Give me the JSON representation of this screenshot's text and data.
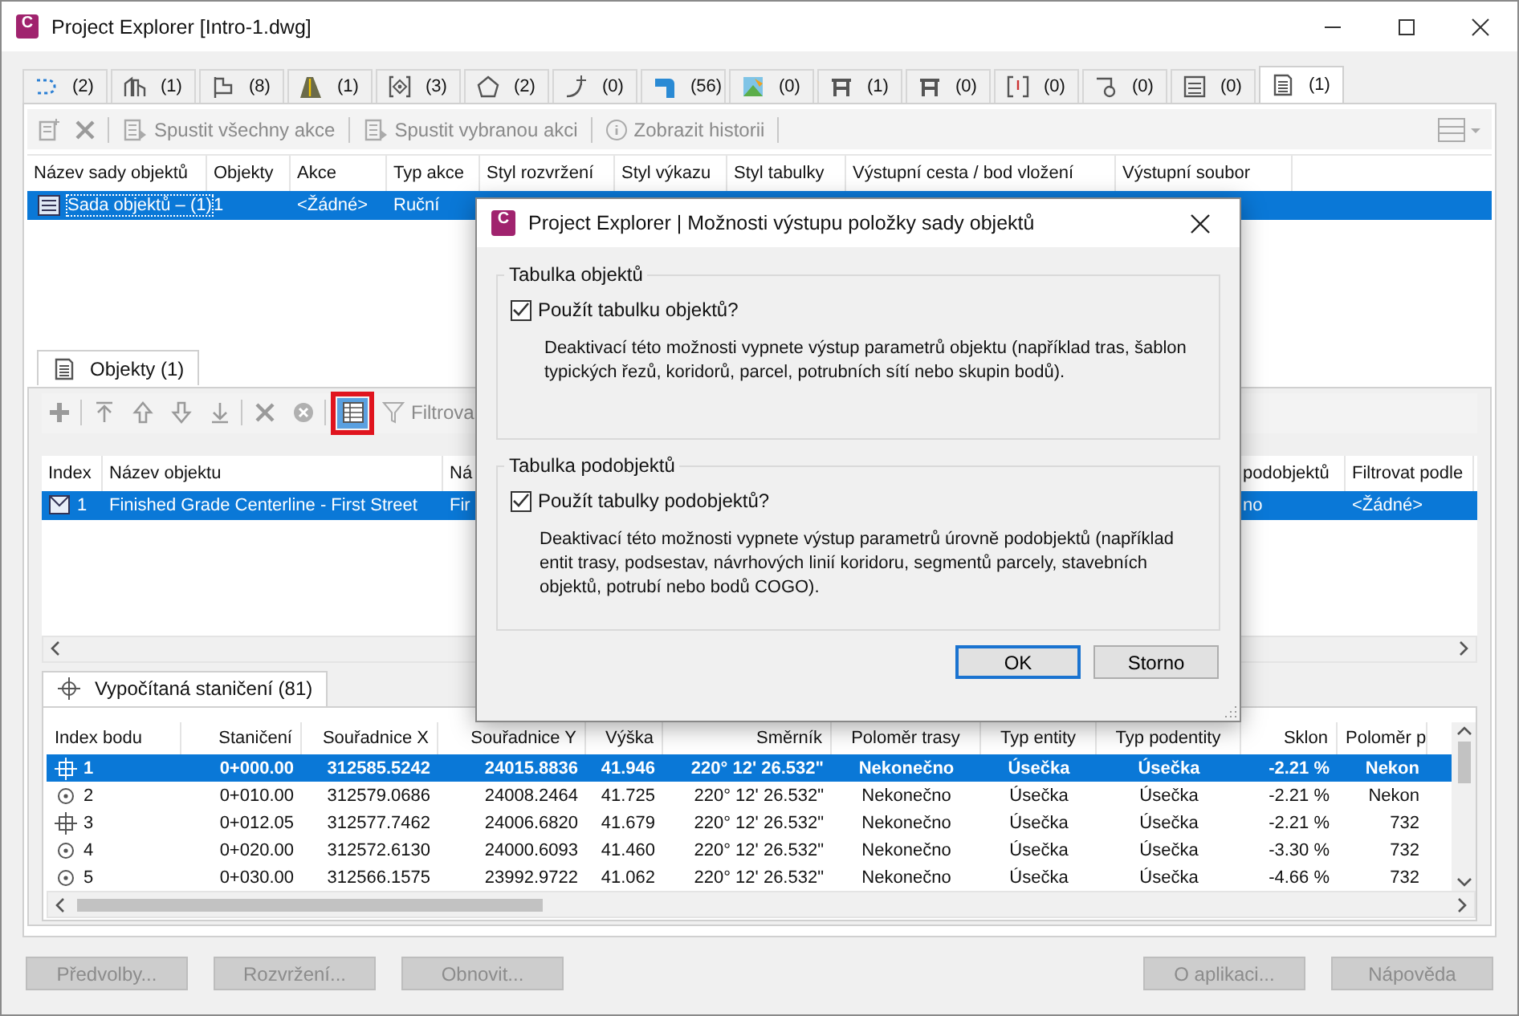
{
  "window": {
    "icon_letter": "C",
    "title": "Project Explorer [Intro-1.dwg]"
  },
  "object_type_tabs": [
    {
      "count": "(2)",
      "selected": false
    },
    {
      "count": "(1)",
      "selected": false
    },
    {
      "count": "(8)",
      "selected": false
    },
    {
      "count": "(1)",
      "selected": false
    },
    {
      "count": "(3)",
      "selected": false
    },
    {
      "count": "(2)",
      "selected": false
    },
    {
      "count": "(0)",
      "selected": false
    },
    {
      "count": "(56)",
      "selected": false
    },
    {
      "count": "(0)",
      "selected": false
    },
    {
      "count": "(1)",
      "selected": false
    },
    {
      "count": "(0)",
      "selected": false
    },
    {
      "count": "(0)",
      "selected": false
    },
    {
      "count": "(0)",
      "selected": false
    },
    {
      "count": "(0)",
      "selected": false
    },
    {
      "count": "(1)",
      "selected": true
    }
  ],
  "toolbar": {
    "buttons": [
      {
        "label": "Spustit všechny akce",
        "disabled": true
      },
      {
        "label": "Spustit vybranou akci",
        "disabled": true
      },
      {
        "label": "Zobrazit historii",
        "disabled": true
      }
    ]
  },
  "object_sets": {
    "columns": [
      "Název sady objektů",
      "Objekty",
      "Akce",
      "Typ akce",
      "Styl rozvržení",
      "Styl výkazu",
      "Styl tabulky",
      "Výstupní cesta / bod vložení",
      "Výstupní soubor"
    ],
    "rows": [
      {
        "selected": true,
        "cells": [
          "Sada objektů – (1)",
          "1",
          "<Žádné>",
          "Ruční"
        ]
      }
    ]
  },
  "objects_tab": {
    "label": "Objekty (1)"
  },
  "objects_toolbar": {
    "tools": [
      {
        "disabled": true,
        "highlighted": false
      },
      {
        "disabled": true,
        "highlighted": false
      },
      {
        "disabled": true,
        "highlighted": false
      },
      {
        "disabled": true,
        "highlighted": false
      },
      {
        "disabled": true,
        "highlighted": false
      },
      {
        "disabled": true,
        "highlighted": false
      },
      {
        "disabled": true,
        "highlighted": false
      },
      {
        "disabled": false,
        "highlighted": true
      }
    ],
    "filter_label": "Filtrova"
  },
  "objects": {
    "columns": [
      "Index",
      "Název objektu",
      "Ná",
      "podobjektů",
      "Filtrovat podle"
    ],
    "rows": [
      {
        "selected": true,
        "cells": [
          "1",
          "Finished Grade Centerline - First Street",
          "Fir",
          "no",
          "<Žádné>"
        ]
      }
    ]
  },
  "stations": {
    "tab": "Vypočítaná staničení (81)",
    "columns": [
      "Index bodu",
      "Staničení",
      "Souřadnice X",
      "Souřadnice Y",
      "Výška",
      "Směrník",
      "Poloměr trasy",
      "Typ entity",
      "Typ podentity",
      "Sklon",
      "Poloměr p"
    ],
    "rows": [
      {
        "kind": "crosshair",
        "selected": true,
        "cells": [
          "1",
          "0+000.00",
          "312585.5242",
          "24015.8836",
          "41.946",
          "220° 12' 26.532\"",
          "Nekonečno",
          "Úsečka",
          "Úsečka",
          "-2.21 %",
          "Nekon"
        ]
      },
      {
        "kind": "circle",
        "selected": false,
        "cells": [
          "2",
          "0+010.00",
          "312579.0686",
          "24008.2464",
          "41.725",
          "220° 12' 26.532\"",
          "Nekonečno",
          "Úsečka",
          "Úsečka",
          "-2.21 %",
          "Nekon"
        ]
      },
      {
        "kind": "crosshair",
        "selected": false,
        "cells": [
          "3",
          "0+012.05",
          "312577.7462",
          "24006.6820",
          "41.679",
          "220° 12' 26.532\"",
          "Nekonečno",
          "Úsečka",
          "Úsečka",
          "-2.21 %",
          "732"
        ]
      },
      {
        "kind": "circle",
        "selected": false,
        "cells": [
          "4",
          "0+020.00",
          "312572.6130",
          "24000.6093",
          "41.460",
          "220° 12' 26.532\"",
          "Nekonečno",
          "Úsečka",
          "Úsečka",
          "-3.30 %",
          "732"
        ]
      },
      {
        "kind": "circle",
        "selected": false,
        "cells": [
          "5",
          "0+030.00",
          "312566.1575",
          "23992.9722",
          "41.062",
          "220° 12' 26.532\"",
          "Nekonečno",
          "Úsečka",
          "Úsečka",
          "-4.66 %",
          "732"
        ]
      }
    ]
  },
  "footer": {
    "left_buttons": [
      {
        "label": "Předvolby...",
        "disabled": true
      },
      {
        "label": "Rozvržení...",
        "disabled": true
      },
      {
        "label": "Obnovit...",
        "disabled": true
      }
    ],
    "right_buttons": [
      {
        "label": "O aplikaci...",
        "disabled": true
      },
      {
        "label": "Nápověda",
        "disabled": true
      }
    ]
  },
  "dialog": {
    "icon_letter": "C",
    "title": "Project Explorer | Možnosti výstupu položky sady objektů",
    "groups": [
      {
        "title": "Tabulka objektů",
        "option": {
          "label": "Použít tabulku objektů?",
          "checked": true
        },
        "description": "Deaktivací této možnosti vypnete výstup parametrů objektu (například tras, šablon typických řezů, koridorů, parcel, potrubních sítí nebo skupin bodů)."
      },
      {
        "title": "Tabulka podobjektů",
        "option": {
          "label": "Použít tabulky podobjektů?",
          "checked": true
        },
        "description": "Deaktivací této možnosti vypnete výstup parametrů úrovně podobjektů (například entit trasy, podsestav, návrhových linií koridoru, segmentů parcely, stavebních objektů, potrubí nebo bodů COGO)."
      }
    ],
    "buttons": [
      {
        "label": "OK",
        "default": true
      },
      {
        "label": "Storno",
        "default": false
      }
    ]
  }
}
